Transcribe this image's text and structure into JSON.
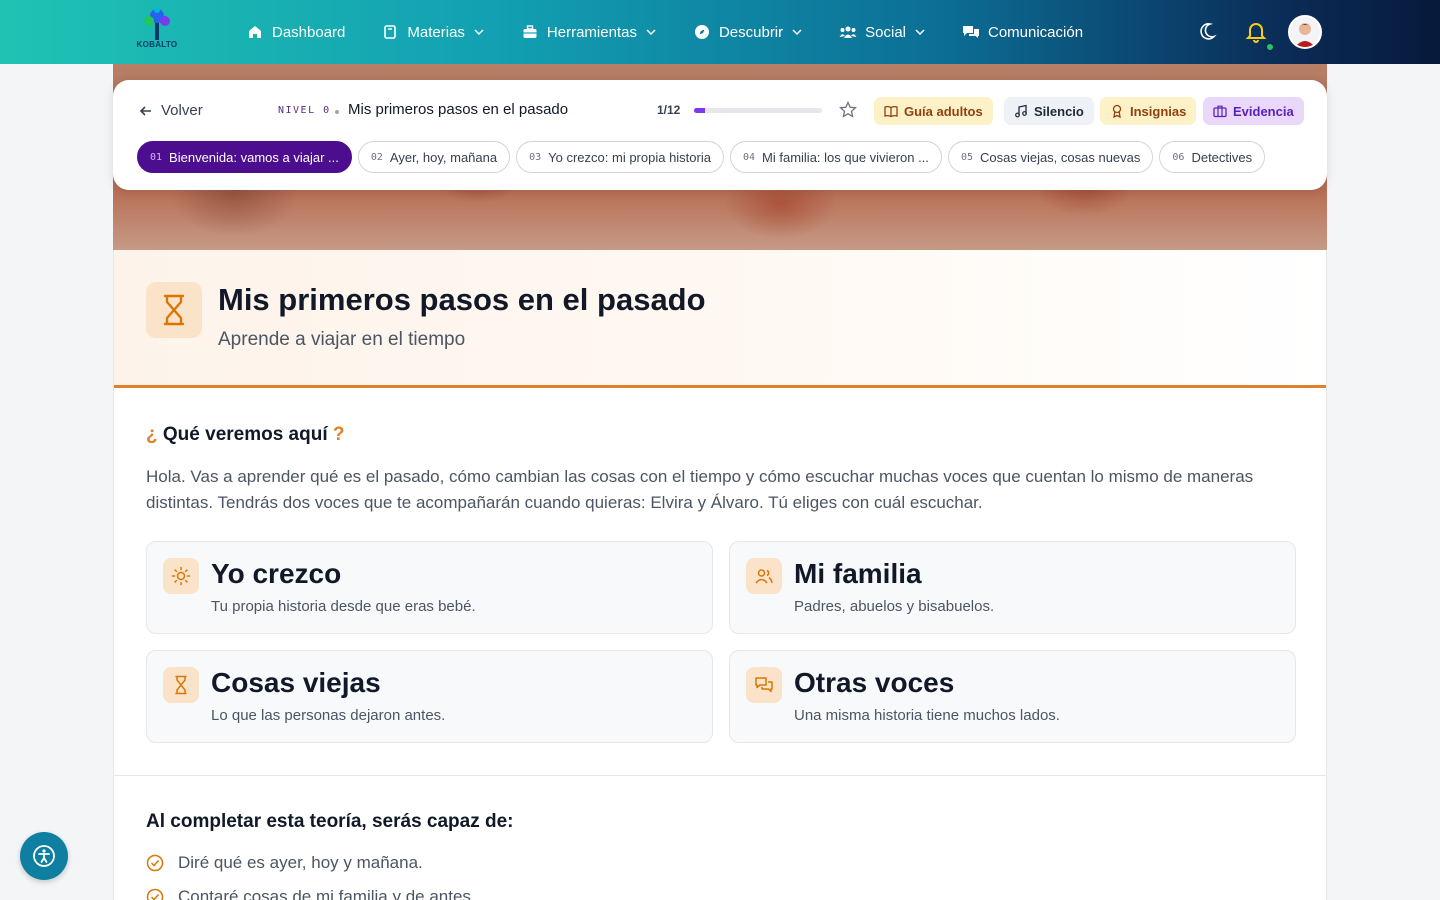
{
  "brand": {
    "logo_text": "KOBALTO"
  },
  "nav": {
    "items": [
      {
        "label": "Dashboard",
        "icon": "home-icon",
        "dropdown": false
      },
      {
        "label": "Materias",
        "icon": "book-icon",
        "dropdown": true
      },
      {
        "label": "Herramientas",
        "icon": "toolbox-icon",
        "dropdown": true
      },
      {
        "label": "Descubrir",
        "icon": "compass-icon",
        "dropdown": true
      },
      {
        "label": "Social",
        "icon": "users-icon",
        "dropdown": true
      },
      {
        "label": "Comunicación",
        "icon": "chat-icon",
        "dropdown": false
      }
    ]
  },
  "topbar": {
    "back_label": "Volver",
    "level_label": "NIVEL 0",
    "topic_title": "Mis primeros pasos en el pasado",
    "progress_label": "1/12",
    "progress_fraction": 0.083,
    "pills": {
      "guide": "Guía adultos",
      "silence": "Silencio",
      "badges": "Insignias",
      "evidence": "Evidencia"
    },
    "tabs": [
      {
        "num": "01",
        "label": "Bienvenida: vamos a viajar ..."
      },
      {
        "num": "02",
        "label": "Ayer, hoy, mañana"
      },
      {
        "num": "03",
        "label": "Yo crezco: mi propia historia"
      },
      {
        "num": "04",
        "label": "Mi familia: los que vivieron ..."
      },
      {
        "num": "05",
        "label": "Cosas viejas, cosas nuevas"
      },
      {
        "num": "06",
        "label": "Detectives"
      }
    ]
  },
  "header": {
    "title": "Mis primeros pasos en el pasado",
    "subtitle": "Aprende a viajar en el tiempo"
  },
  "section": {
    "q_open": "¿",
    "title": "Qué veremos aquí",
    "q_close": "?",
    "intro": "Hola. Vas a aprender qué es el pasado, cómo cambian las cosas con el tiempo y cómo escuchar muchas voces que cuentan lo mismo de maneras distintas. Tendrás dos voces que te acompañarán cuando quieras: Elvira y Álvaro. Tú eliges con cuál escuchar."
  },
  "features": [
    {
      "title": "Yo crezco",
      "desc": "Tu propia historia desde que eras bebé.",
      "icon": "sun-icon"
    },
    {
      "title": "Mi familia",
      "desc": "Padres, abuelos y bisabuelos.",
      "icon": "family-icon"
    },
    {
      "title": "Cosas viejas",
      "desc": "Lo que las personas dejaron antes.",
      "icon": "hourglass-icon"
    },
    {
      "title": "Otras voces",
      "desc": "Una misma historia tiene muchos lados.",
      "icon": "speech-bubbles-icon"
    }
  ],
  "goals": {
    "title": "Al completar esta teoría, serás capaz de:",
    "items": [
      "Diré qué es ayer, hoy y mañana.",
      "Contaré cosas de mi familia y de antes."
    ]
  },
  "colors": {
    "accent": "#e0802a",
    "active_tab": "#4c0d8f",
    "nav_start": "#1fc3b3",
    "nav_end": "#08193a"
  }
}
